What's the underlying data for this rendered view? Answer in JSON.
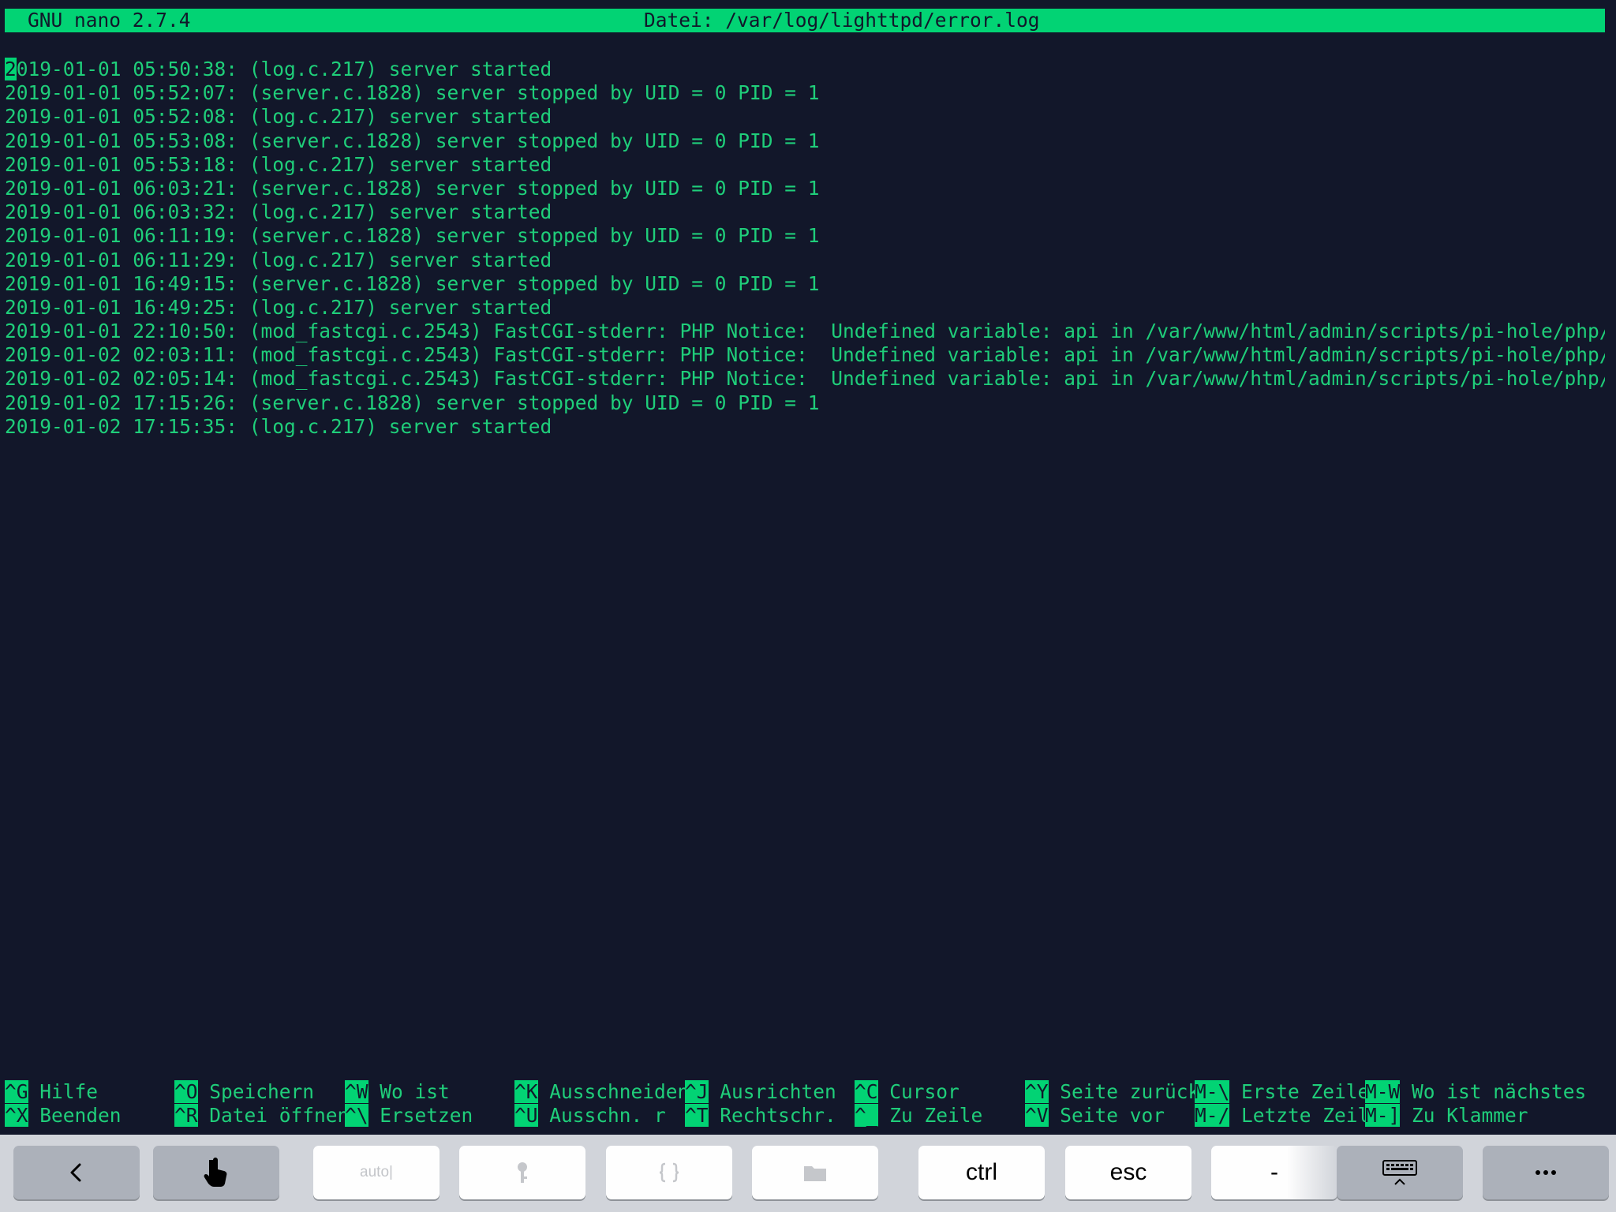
{
  "titlebar": {
    "app": "GNU nano 2.7.4",
    "file": "Datei: /var/log/lighttpd/error.log"
  },
  "log": {
    "cursor_char": "2",
    "first_rest": "019-01-01 05:50:38: (log.c.217) server started",
    "lines": [
      "2019-01-01 05:52:07: (server.c.1828) server stopped by UID = 0 PID = 1",
      "2019-01-01 05:52:08: (log.c.217) server started",
      "2019-01-01 05:53:08: (server.c.1828) server stopped by UID = 0 PID = 1",
      "2019-01-01 05:53:18: (log.c.217) server started",
      "2019-01-01 06:03:21: (server.c.1828) server stopped by UID = 0 PID = 1",
      "2019-01-01 06:03:32: (log.c.217) server started",
      "2019-01-01 06:11:19: (server.c.1828) server stopped by UID = 0 PID = 1",
      "2019-01-01 06:11:29: (log.c.217) server started",
      "2019-01-01 16:49:15: (server.c.1828) server stopped by UID = 0 PID = 1",
      "2019-01-01 16:49:25: (log.c.217) server started",
      "2019-01-01 22:10:50: (mod_fastcgi.c.2543) FastCGI-stderr: PHP Notice:  Undefined variable: api in /var/www/html/admin/scripts/pi-hole/php/ad$",
      "2019-01-02 02:03:11: (mod_fastcgi.c.2543) FastCGI-stderr: PHP Notice:  Undefined variable: api in /var/www/html/admin/scripts/pi-hole/php/ad$",
      "2019-01-02 02:05:14: (mod_fastcgi.c.2543) FastCGI-stderr: PHP Notice:  Undefined variable: api in /var/www/html/admin/scripts/pi-hole/php/su$",
      "2019-01-02 17:15:26: (server.c.1828) server stopped by UID = 0 PID = 1",
      "2019-01-02 17:15:35: (log.c.217) server started"
    ]
  },
  "shortcuts": [
    {
      "key": "^G",
      "label": " Hilfe"
    },
    {
      "key": "^O",
      "label": " Speichern"
    },
    {
      "key": "^W",
      "label": " Wo ist"
    },
    {
      "key": "^K",
      "label": " Ausschneiden"
    },
    {
      "key": "^J",
      "label": " Ausrichten"
    },
    {
      "key": "^C",
      "label": " Cursor"
    },
    {
      "key": "^Y",
      "label": " Seite zurück"
    },
    {
      "key": "M-\\",
      "label": " Erste Zeile"
    },
    {
      "key": "M-W",
      "label": " Wo ist nächstes"
    },
    {
      "key": "^X",
      "label": " Beenden"
    },
    {
      "key": "^R",
      "label": " Datei öffnen"
    },
    {
      "key": "^\\",
      "label": " Ersetzen"
    },
    {
      "key": "^U",
      "label": " Ausschn. r"
    },
    {
      "key": "^T",
      "label": " Rechtschr."
    },
    {
      "key": "^_",
      "label": " Zu Zeile"
    },
    {
      "key": "^V",
      "label": " Seite vor"
    },
    {
      "key": "M-/",
      "label": " Letzte Zeil"
    },
    {
      "key": "M-]",
      "label": " Zu Klammer"
    }
  ],
  "keybar": {
    "auto": "auto",
    "ctrl": "ctrl",
    "esc": "esc",
    "dash": "-",
    "icons": {
      "back": "chevron-left-icon",
      "touch": "hand-pointer-icon",
      "password": "key-icon",
      "snippets": "braces-icon",
      "files": "folder-icon",
      "keyboard": "keyboard-hide-icon",
      "more": "ellipsis-icon"
    }
  },
  "colors": {
    "background": "#12172a",
    "text": "#1fce7a",
    "accent": "#02d374",
    "keybar": "#d1d4da"
  }
}
